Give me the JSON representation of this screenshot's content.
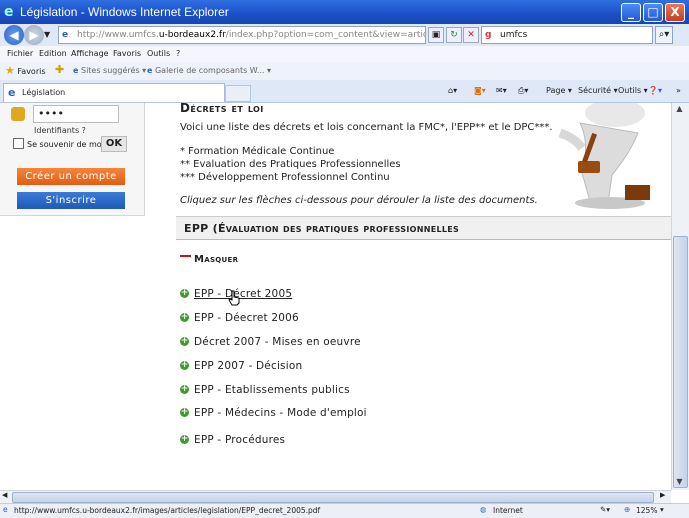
{
  "window": {
    "title": "Législation - Windows Internet Explorer",
    "min_label": "_",
    "max_label": "□",
    "close_label": "X"
  },
  "address": {
    "url_prefix": "http://www.umfcs.",
    "url_host": "u-bordeaux2.fr",
    "url_suffix": "/index.php?option=com_content&view=article&id=87&Itemid=59"
  },
  "search": {
    "value": "umfcs"
  },
  "menu": [
    "Fichier",
    "Edition",
    "Affichage",
    "Favoris",
    "Outils",
    "?"
  ],
  "favorites": {
    "label": "Favoris",
    "suggested": "Sites suggérés ▾",
    "gallery": "Galerie de composants W... ▾"
  },
  "tab": {
    "label": "Législation"
  },
  "toolbar": {
    "page": "Page ▾",
    "security": "Sécurité ▾",
    "tools": "Outils ▾"
  },
  "login": {
    "password_value": "••••",
    "identifiants": "Identifiants ?",
    "remember": "Se souvenir de moi",
    "ok": "OK",
    "create_account": "Créer un compte",
    "signup": "S'inscrire"
  },
  "content": {
    "heading": "Décrets et loi",
    "intro": "Voici une liste des décrets et lois concernant la FMC*, l'EPP** et le DPC***.",
    "footnotes": [
      "* Formation Médicale Continue",
      "** Evaluation des Pratiques Professionnelles",
      "*** Développement Professionnel Continu"
    ],
    "hint": "Cliquez sur les flèches ci-dessous pour dérouler la liste des documents.",
    "section_title": "EPP (Évaluation des pratiques professionnelles",
    "masquer": "Masquer",
    "documents": [
      "EPP - Décret 2005",
      "EPP - Déecret 2006",
      "Décret 2007 - Mises en oeuvre",
      "EPP 2007 - Décision",
      "EPP - Etablissements publics",
      "EPP - Médecins - Mode d'emploi",
      "EPP - Procédures"
    ]
  },
  "status": {
    "url": "http://www.umfcs.u-bordeaux2.fr/images/articles/legislation/EPP_decret_2005.pdf",
    "zone": "Internet",
    "zoom": "125%"
  }
}
